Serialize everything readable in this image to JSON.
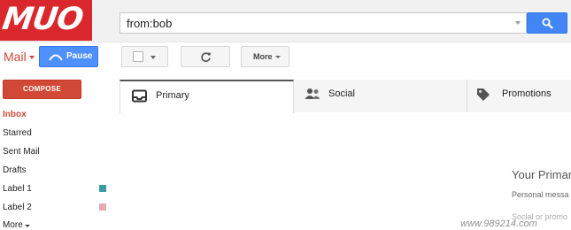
{
  "logo": {
    "text": "MUO"
  },
  "search": {
    "value": "from:bob"
  },
  "header": {
    "app_label": "Mail",
    "pause_label": "Pause"
  },
  "toolbar": {
    "more_label": "More"
  },
  "sidebar": {
    "compose_label": "COMPOSE",
    "items": [
      {
        "label": "Inbox"
      },
      {
        "label": "Starred"
      },
      {
        "label": "Sent Mail"
      },
      {
        "label": "Drafts"
      },
      {
        "label": "Label 1",
        "color": "#3b9ca6"
      },
      {
        "label": "Label 2",
        "color": "#e7a8b3"
      },
      {
        "label": "More"
      }
    ]
  },
  "tabs": [
    {
      "label": "Primary",
      "icon": "inbox-tray-icon"
    },
    {
      "label": "Social",
      "icon": "people-icon"
    },
    {
      "label": "Promotions",
      "icon": "tag-icon"
    }
  ],
  "empty_state": {
    "title": "Your Primar",
    "subtitle": "Personal messa",
    "subtitle2": "Social or promo"
  },
  "watermark": {
    "text": "www.989214.com"
  },
  "colors": {
    "brand_red": "#d9272d",
    "search_blue": "#4285f4",
    "compose_red": "#d14836"
  }
}
